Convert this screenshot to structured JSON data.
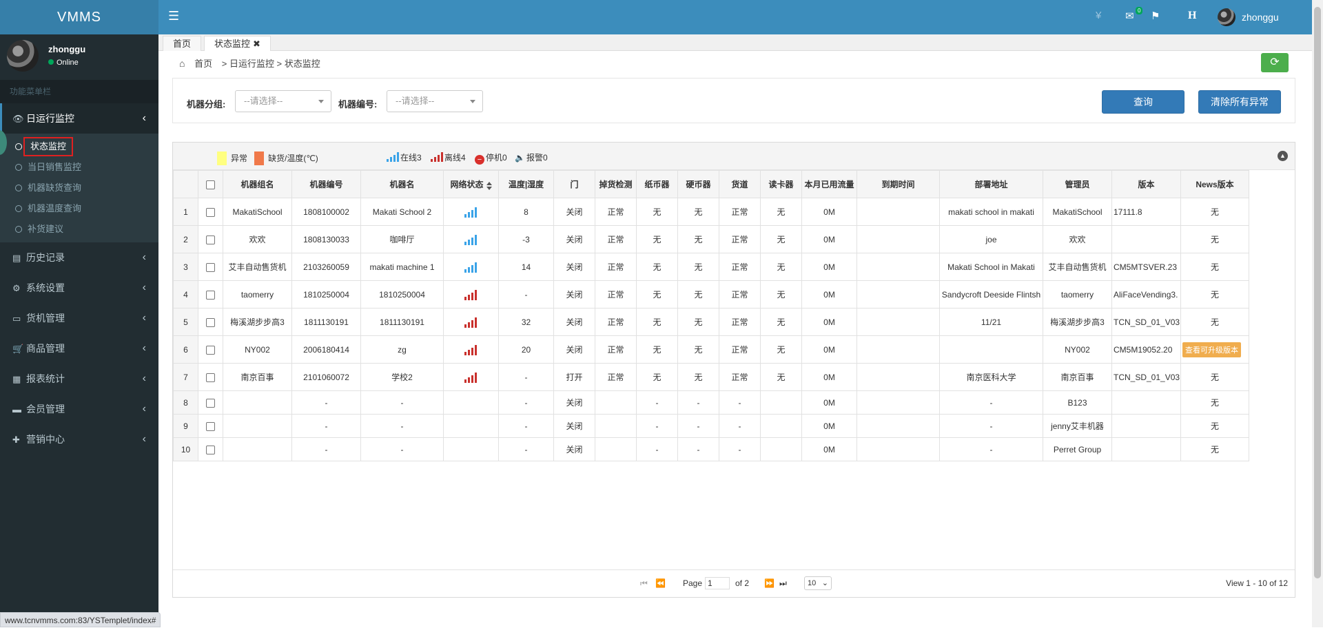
{
  "app": {
    "title": "VMMS"
  },
  "user": {
    "name": "zhonggu",
    "status": "Online"
  },
  "sidebar": {
    "header": "功能菜单栏",
    "group_active": {
      "label": "日运行监控",
      "icon": "eye-icon"
    },
    "sub_items": [
      "状态监控",
      "当日销售监控",
      "机器缺货查询",
      "机器温度查询",
      "补货建议"
    ],
    "items": [
      {
        "label": "历史记录",
        "icon": "file-icon"
      },
      {
        "label": "系统设置",
        "icon": "gear-icon"
      },
      {
        "label": "货机管理",
        "icon": "laptop-icon"
      },
      {
        "label": "商品管理",
        "icon": "cart-icon"
      },
      {
        "label": "报表统计",
        "icon": "table-icon"
      },
      {
        "label": "会员管理",
        "icon": "card-icon"
      },
      {
        "label": "营销中心",
        "icon": "gift-icon"
      }
    ]
  },
  "topbar": {
    "badge": "0",
    "h_label": "H",
    "user": "zhonggu"
  },
  "tabs": [
    {
      "label": "首页"
    },
    {
      "label": "状态监控"
    }
  ],
  "breadcrumb": {
    "home": "首页",
    "path": "> 日运行监控 > 状态监控"
  },
  "filter": {
    "group_label": "机器分组:",
    "group_placeholder": "--请选择--",
    "number_label": "机器编号:",
    "number_placeholder": "--请选择--",
    "query_button": "查询",
    "clear_button": "清除所有异常"
  },
  "legend": {
    "abnormal": "异常",
    "shortage": "缺货/温度(℃)",
    "online": "在线3",
    "offline": "离线4",
    "stopped": "停机0",
    "alarm": "报警0",
    "colors": {
      "abnormal": "#ffff80",
      "shortage": "#f0794a"
    }
  },
  "table": {
    "columns": [
      "",
      "",
      "机器组名",
      "机器编号",
      "机器名",
      "网络状态",
      "温度|湿度",
      "门",
      "掉货检测",
      "纸币器",
      "硬币器",
      "货道",
      "读卡器",
      "本月已用流量",
      "到期时间",
      "部署地址",
      "管理员",
      "版本",
      "News版本"
    ],
    "rows": [
      {
        "n": "1",
        "group": "MakatiSchool",
        "code": "1808100002",
        "name": "Makati School 2",
        "net": "online",
        "temp": "8",
        "door": "关闭",
        "drop": "正常",
        "note": "无",
        "coin": "无",
        "lane": "正常",
        "card": "无",
        "flow": "0M",
        "expire": "",
        "addr": "makati school in makati",
        "admin": "MakatiSchool",
        "ver": "17111.8",
        "news": "无"
      },
      {
        "n": "2",
        "group": "欢欢",
        "code": "1808130033",
        "name": "咖啡厅",
        "net": "online",
        "temp": "-3",
        "door": "关闭",
        "drop": "正常",
        "note": "无",
        "coin": "无",
        "lane": "正常",
        "card": "无",
        "flow": "0M",
        "expire": "",
        "addr": "joe",
        "admin": "欢欢",
        "ver": "",
        "news": "无"
      },
      {
        "n": "3",
        "group": "艾丰自动售货机",
        "code": "2103260059",
        "name": "makati machine 1",
        "net": "online",
        "temp": "14",
        "door": "关闭",
        "drop": "正常",
        "note": "无",
        "coin": "无",
        "lane": "正常",
        "card": "无",
        "flow": "0M",
        "expire": "",
        "addr": "Makati School in Makati",
        "admin": "艾丰自动售货机",
        "ver": "CM5MTSVER.23",
        "news": "无"
      },
      {
        "n": "4",
        "group": "taomerry",
        "code": "1810250004",
        "name": "1810250004",
        "net": "offline",
        "temp": "-",
        "door": "关闭",
        "drop": "正常",
        "note": "无",
        "coin": "无",
        "lane": "正常",
        "card": "无",
        "flow": "0M",
        "expire": "",
        "addr": "Sandycroft Deeside Flintsh",
        "admin": "taomerry",
        "ver": "AliFaceVending3.",
        "news": "无"
      },
      {
        "n": "5",
        "group": "梅溪湖步步高3",
        "code": "1811130191",
        "name": "1811130191",
        "net": "offline",
        "temp": "32",
        "door": "关闭",
        "drop": "正常",
        "note": "无",
        "coin": "无",
        "lane": "正常",
        "card": "无",
        "flow": "0M",
        "expire": "",
        "addr": "11/21",
        "admin": "梅溪湖步步高3",
        "ver": "TCN_SD_01_V03",
        "news": "无"
      },
      {
        "n": "6",
        "group": "NY002",
        "code": "2006180414",
        "name": "zg",
        "net": "offline",
        "temp": "20",
        "door": "关闭",
        "drop": "正常",
        "note": "无",
        "coin": "无",
        "lane": "正常",
        "card": "无",
        "flow": "0M",
        "expire": "",
        "addr": "",
        "admin": "NY002",
        "ver": "CM5M19052.20",
        "news": "查看可升级版本"
      },
      {
        "n": "7",
        "group": "南京百事",
        "code": "2101060072",
        "name": "学校2",
        "net": "offline",
        "temp": "-",
        "door": "打开",
        "drop": "正常",
        "note": "无",
        "coin": "无",
        "lane": "正常",
        "card": "无",
        "flow": "0M",
        "expire": "",
        "addr": "南京医科大学",
        "admin": "南京百事",
        "ver": "TCN_SD_01_V03",
        "news": "无"
      },
      {
        "n": "8",
        "group": "",
        "code": "-",
        "name": "-",
        "net": "",
        "temp": "-",
        "door": "关闭",
        "drop": "",
        "note": "-",
        "coin": "-",
        "lane": "-",
        "card": "",
        "flow": "0M",
        "expire": "",
        "addr": "-",
        "admin": "B123",
        "ver": "",
        "news": "无"
      },
      {
        "n": "9",
        "group": "",
        "code": "-",
        "name": "-",
        "net": "",
        "temp": "-",
        "door": "关闭",
        "drop": "",
        "note": "-",
        "coin": "-",
        "lane": "-",
        "card": "",
        "flow": "0M",
        "expire": "",
        "addr": "-",
        "admin": "jenny艾丰机器",
        "ver": "",
        "news": "无"
      },
      {
        "n": "10",
        "group": "",
        "code": "-",
        "name": "-",
        "net": "",
        "temp": "-",
        "door": "关闭",
        "drop": "",
        "note": "-",
        "coin": "-",
        "lane": "-",
        "card": "",
        "flow": "0M",
        "expire": "",
        "addr": "-",
        "admin": "Perret Group",
        "ver": "",
        "news": "无"
      }
    ]
  },
  "pager": {
    "page_label": "Page",
    "page_value": "1",
    "of_label": "of 2",
    "per_page": "10",
    "summary": "View 1 - 10 of 12"
  },
  "statusbar": {
    "url": "www.tcnvmms.com:83/YSTemplet/index#"
  }
}
